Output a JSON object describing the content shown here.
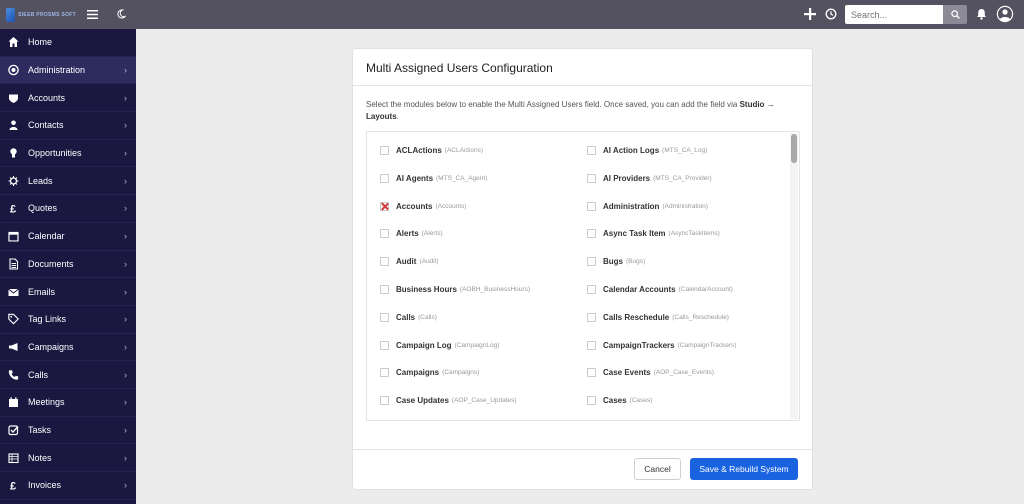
{
  "topbar": {
    "logo_text": "SIEEB PROSMS SOFT",
    "search": {
      "placeholder": "Search...",
      "value": ""
    },
    "icons": [
      "hamburger-icon",
      "moon-icon",
      "plus-icon",
      "history-icon",
      "search-icon",
      "bell-icon",
      "user-avatar-icon"
    ]
  },
  "sidebar": {
    "items": [
      {
        "label": "Home",
        "icon": "home-icon",
        "active": false
      },
      {
        "label": "Administration",
        "icon": "admin-icon",
        "active": true
      },
      {
        "label": "Accounts",
        "icon": "accounts-icon",
        "active": false
      },
      {
        "label": "Contacts",
        "icon": "contacts-icon",
        "active": false
      },
      {
        "label": "Opportunities",
        "icon": "lightbulb-icon",
        "active": false
      },
      {
        "label": "Leads",
        "icon": "leads-icon",
        "active": false
      },
      {
        "label": "Quotes",
        "icon": "pound-icon",
        "active": false
      },
      {
        "label": "Calendar",
        "icon": "calendar-icon",
        "active": false
      },
      {
        "label": "Documents",
        "icon": "document-icon",
        "active": false
      },
      {
        "label": "Emails",
        "icon": "envelope-icon",
        "active": false
      },
      {
        "label": "Tag Links",
        "icon": "tag-icon",
        "active": false
      },
      {
        "label": "Campaigns",
        "icon": "megaphone-icon",
        "active": false
      },
      {
        "label": "Calls",
        "icon": "phone-icon",
        "active": false
      },
      {
        "label": "Meetings",
        "icon": "meetings-icon",
        "active": false
      },
      {
        "label": "Tasks",
        "icon": "tasks-icon",
        "active": false
      },
      {
        "label": "Notes",
        "icon": "notes-icon",
        "active": false
      },
      {
        "label": "Invoices",
        "icon": "pound-icon",
        "active": false
      }
    ]
  },
  "panel": {
    "title": "Multi Assigned Users Configuration",
    "description_prefix": "Select the modules below to enable the Multi Assigned Users field. Once saved, you can add the field via ",
    "description_bold": "Studio → Layouts",
    "description_suffix": ".",
    "modules": [
      {
        "name": "ACLActions",
        "key": "(ACLActions)",
        "checked": false
      },
      {
        "name": "AI Action Logs",
        "key": "(MTS_CA_Log)",
        "checked": false
      },
      {
        "name": "AI Agents",
        "key": "(MTS_CA_Agent)",
        "checked": false
      },
      {
        "name": "AI Providers",
        "key": "(MTS_CA_Provider)",
        "checked": false
      },
      {
        "name": "Accounts",
        "key": "(Accounts)",
        "checked": true
      },
      {
        "name": "Administration",
        "key": "(Administration)",
        "checked": false
      },
      {
        "name": "Alerts",
        "key": "(Alerts)",
        "checked": false
      },
      {
        "name": "Async Task Item",
        "key": "(AsyncTaskItems)",
        "checked": false
      },
      {
        "name": "Audit",
        "key": "(Audit)",
        "checked": false
      },
      {
        "name": "Bugs",
        "key": "(Bugs)",
        "checked": false
      },
      {
        "name": "Business Hours",
        "key": "(AOBH_BusinessHours)",
        "checked": false
      },
      {
        "name": "Calendar Accounts",
        "key": "(CalendarAccount)",
        "checked": false
      },
      {
        "name": "Calls",
        "key": "(Calls)",
        "checked": false
      },
      {
        "name": "Calls Reschedule",
        "key": "(Calls_Reschedule)",
        "checked": false
      },
      {
        "name": "Campaign Log",
        "key": "(CampaignLog)",
        "checked": false
      },
      {
        "name": "CampaignTrackers",
        "key": "(CampaignTrackers)",
        "checked": false
      },
      {
        "name": "Campaigns",
        "key": "(Campaigns)",
        "checked": false
      },
      {
        "name": "Case Events",
        "key": "(AOP_Case_Events)",
        "checked": false
      },
      {
        "name": "Case Updates",
        "key": "(AOP_Case_Updates)",
        "checked": false
      },
      {
        "name": "Cases",
        "key": "(Cases)",
        "checked": false
      }
    ],
    "cancel_label": "Cancel",
    "save_label": "Save & Rebuild System"
  },
  "colors": {
    "topbar": "#545261",
    "sidebar": "#1a1740",
    "sidebar_active": "#2e2b5e",
    "primary_button": "#1a63e0",
    "checked_mark": "#d13a3a"
  }
}
